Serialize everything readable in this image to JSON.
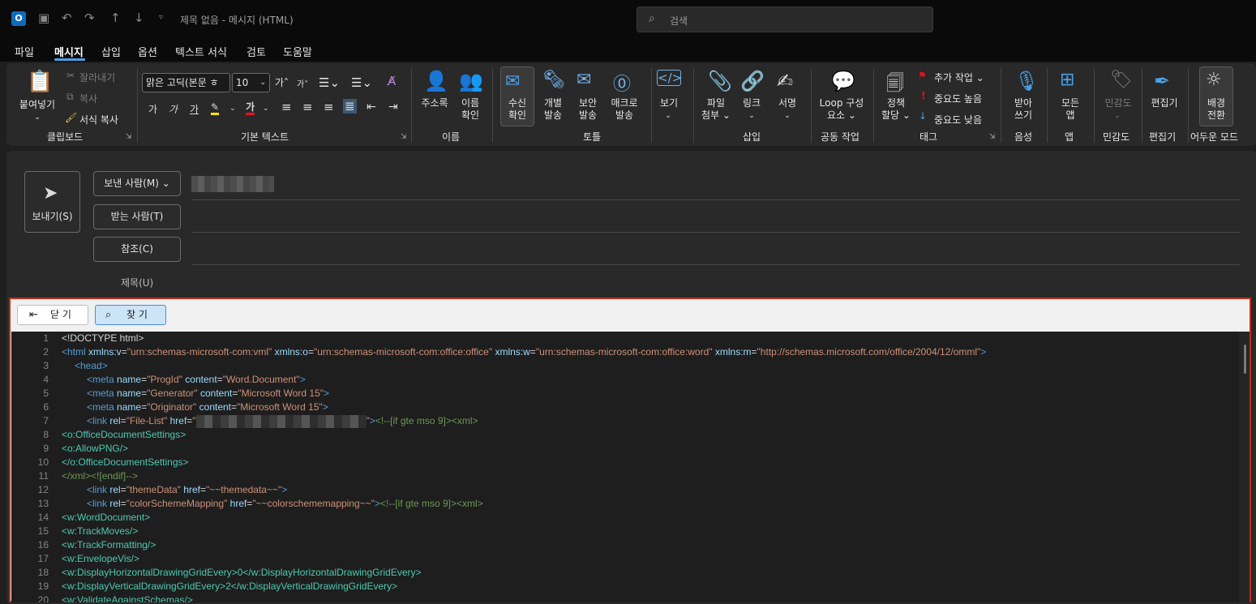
{
  "titlebar": {
    "title": "제목 없음  -  메시지 (HTML)",
    "search_placeholder": "검색"
  },
  "menu": [
    "파일",
    "메시지",
    "삽입",
    "옵션",
    "텍스트 서식",
    "검토",
    "도움말"
  ],
  "ribbon": {
    "clipboard": {
      "paste": "붙여넣기",
      "cut": "잘라내기",
      "copy": "복사",
      "format_painter": "서식 복사",
      "group": "클립보드"
    },
    "basic_text": {
      "font": "맑은 고딕(본문 ㅎ",
      "size": "10",
      "bold": "가",
      "italic": "가",
      "underline": "가",
      "font_color_glyph": "가",
      "grow": "가",
      "shrink": "가",
      "group": "기본 텍스트"
    },
    "names": {
      "address_book": "주소록",
      "check_names_1": "이름",
      "check_names_2": "확인",
      "group": "이름"
    },
    "tollgate": {
      "read_receipt_1": "수신",
      "read_receipt_2": "확인",
      "individual_1": "개별",
      "individual_2": "발송",
      "secure_1": "보안",
      "secure_2": "발송",
      "macro_1": "매크로",
      "macro_2": "발송",
      "group": "토틀"
    },
    "view": {
      "label": "보기"
    },
    "insert": {
      "attach_1": "파일",
      "attach_2": "첨부",
      "link": "링크",
      "signature": "서명",
      "group": "삽입"
    },
    "collab": {
      "loop_1": "Loop 구성",
      "loop_2": "요소",
      "group": "공동 작업"
    },
    "tags": {
      "policy_1": "정책",
      "policy_2": "할당",
      "followup": "추가 작업",
      "high": "중요도 높음",
      "low": "중요도 낮음",
      "group": "태그"
    },
    "voice": {
      "dictate_1": "받아",
      "dictate_2": "쓰기",
      "group": "음성"
    },
    "apps": {
      "all_1": "모든",
      "all_2": "앱",
      "group": "앱"
    },
    "sensitivity": {
      "label": "민감도",
      "group": "민감도"
    },
    "editor": {
      "label": "편집기",
      "group": "편집기"
    },
    "dark": {
      "label_1": "배경",
      "label_2": "전환",
      "group": "어두운 모드"
    }
  },
  "compose": {
    "send": "보내기(S)",
    "from": "보낸 사람(M)",
    "to": "받는 사람(T)",
    "cc": "참조(C)",
    "subject": "제목(U)"
  },
  "source_viewer": {
    "close": "닫 기",
    "find": "찾 기",
    "line_numbers": [
      "1",
      "2",
      "3",
      "4",
      "5",
      "6",
      "7",
      "8",
      "9",
      "10",
      "11",
      "12",
      "13",
      "14",
      "15",
      "16",
      "17",
      "18",
      "19",
      "20"
    ],
    "lines": {
      "l1": "<!DOCTYPE html>",
      "l2_open": "<html ",
      "l2_a1": "xmlns:v",
      "l2_v1": "\"urn:schemas-microsoft-com:vml\"",
      "l2_a2": "xmlns:o",
      "l2_v2": "\"urn:schemas-microsoft-com:office:office\"",
      "l2_a3": "xmlns:w",
      "l2_v3": "\"urn:schemas-microsoft-com:office:word\"",
      "l2_a4": "xmlns:m",
      "l2_v4": "\"http://schemas.microsoft.com/office/2004/12/omml\"",
      "l3": "<head>",
      "l4_open": "<meta ",
      "l4_a1": "name",
      "l4_v1": "\"ProgId\"",
      "l4_a2": "content",
      "l4_v2": "\"Word.Document\"",
      "l5_v1": "\"Generator\"",
      "l5_v2": "\"Microsoft Word 15\"",
      "l6_v1": "\"Originator\"",
      "l6_v2": "\"Microsoft Word 15\"",
      "l7_open": "<link ",
      "l7_a1": "rel",
      "l7_v1": "\"File-List\"",
      "l7_a2": "href",
      "l7_q": "\"",
      "l7_tail": "<!--[if gte mso 9]><xml>",
      "l8": "<o:OfficeDocumentSettings>",
      "l9": "<o:AllowPNG/>",
      "l10": "</o:OfficeDocumentSettings>",
      "l11": "</xml><![endif]-->",
      "l12_a1": "rel",
      "l12_v1": "\"themeData\"",
      "l12_a2": "href",
      "l12_v2": "\"~~themedata~~\"",
      "l13_v1": "\"colorSchemeMapping\"",
      "l13_v2": "\"~~colorschememapping~~\"",
      "l13_tail": "<!--[if gte mso 9]><xml>",
      "l14": "<w:WordDocument>",
      "l15": "<w:TrackMoves/>",
      "l16": "<w:TrackFormatting/>",
      "l17": "<w:EnvelopeVis/>",
      "l18": "<w:DisplayHorizontalDrawingGridEvery>0</w:DisplayHorizontalDrawingGridEvery>",
      "l19": "<w:DisplayVerticalDrawingGridEvery>2</w:DisplayVerticalDrawingGridEvery>",
      "l20": "<w:ValidateAgainstSchemas/>"
    }
  },
  "colors": {
    "accent": "#4aa0e6",
    "highlight_frame": "#c42b1c",
    "tag": "#569cd6",
    "attr": "#9cdcfe",
    "value": "#ce9178",
    "comment": "#6a9955"
  }
}
